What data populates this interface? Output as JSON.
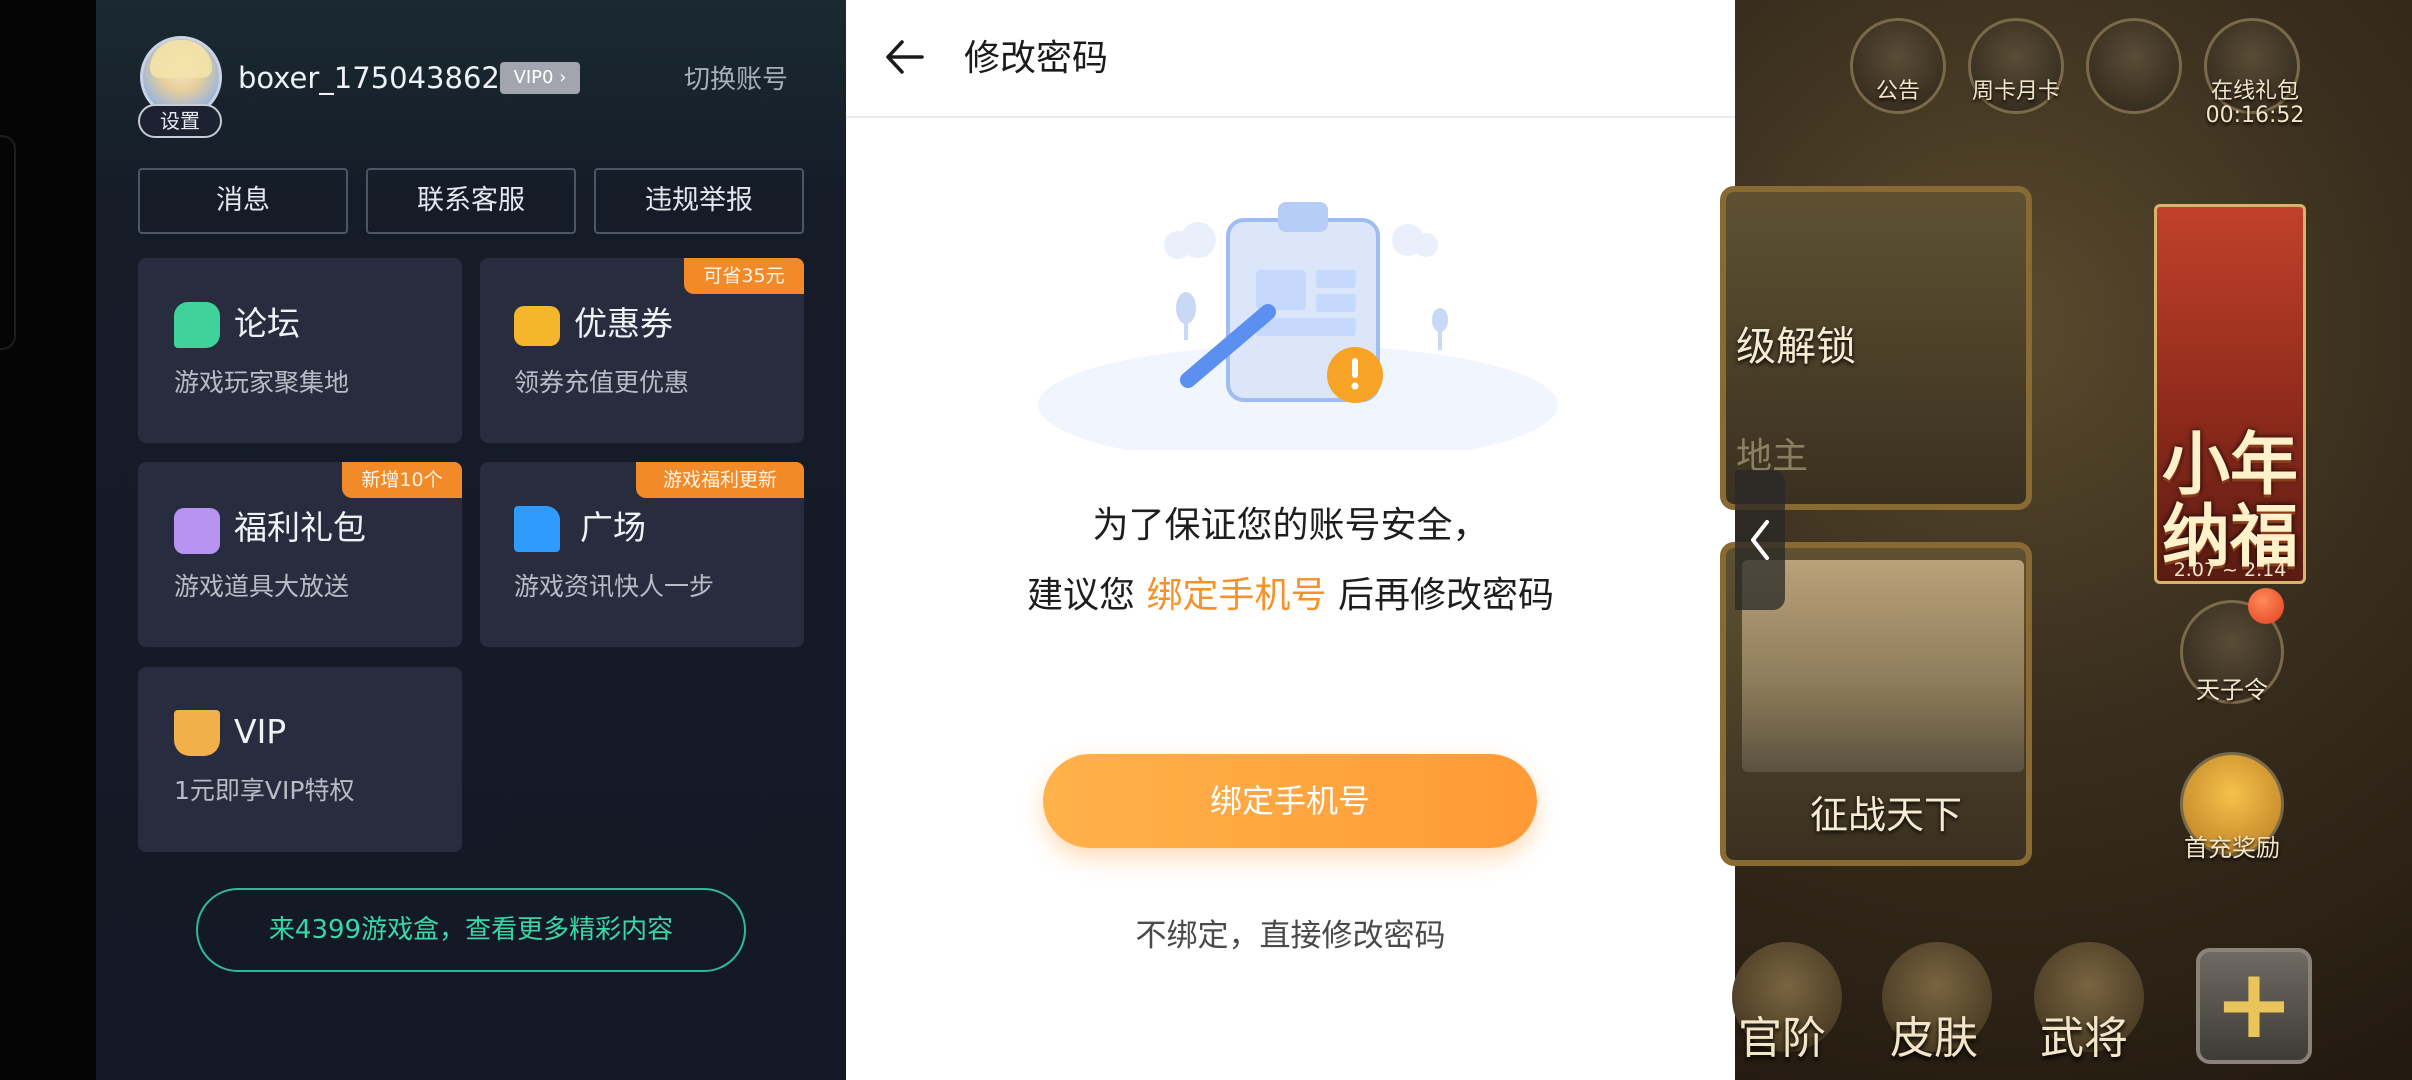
{
  "account_panel": {
    "settings_label": "设置",
    "username": "boxer_175043862rb",
    "vip_badge": "VIP0 ›",
    "switch_account": "切换账号",
    "top_buttons": [
      "消息",
      "联系客服",
      "违规举报"
    ],
    "cards": [
      {
        "title": "论坛",
        "subtitle": "游戏玩家聚集地",
        "icon": "chat-bubble-icon",
        "ribbon": ""
      },
      {
        "title": "优惠券",
        "subtitle": "领券充值更优惠",
        "icon": "coupon-icon",
        "ribbon": "可省35元"
      },
      {
        "title": "福利礼包",
        "subtitle": "游戏道具大放送",
        "icon": "gift-icon",
        "ribbon": "新增10个"
      },
      {
        "title": "广场",
        "subtitle": "游戏资讯快人一步",
        "icon": "flag-icon",
        "ribbon": "游戏福利更新"
      },
      {
        "title": "VIP",
        "subtitle": "1元即享VIP特权",
        "icon": "crown-icon",
        "ribbon": ""
      }
    ],
    "promo_banner": "来4399游戏盒，查看更多精彩内容"
  },
  "dialog": {
    "title": "修改密码",
    "message_line1": "为了保证您的账号安全，",
    "message_line2_pre": "建议您 ",
    "message_line2_highlight": "绑定手机号",
    "message_line2_post": " 后再修改密码",
    "bind_button": "绑定手机号",
    "skip_link": "不绑定，直接修改密码"
  },
  "game": {
    "top_icons": [
      {
        "label": "公告",
        "icon": "announcement-icon"
      },
      {
        "label": "周卡月卡",
        "icon": "card-icon"
      },
      {
        "label": "",
        "icon": "sword-icon"
      },
      {
        "label": "在线礼包",
        "icon": "giftbox-icon"
      }
    ],
    "timer": "00:16:52",
    "banner1_text": "级解锁",
    "banner1_sub": "地主",
    "banner2_text": "征战天下",
    "event_title": "小年纳福",
    "event_dates": "2.07 ~ 2.14",
    "side_icons": [
      {
        "label": "天子令",
        "icon": "token-icon"
      },
      {
        "label": "首充奖励",
        "icon": "first-recharge-icon"
      }
    ],
    "bottom_nav": [
      {
        "label": "官阶",
        "icon": "rank-icon"
      },
      {
        "label": "皮肤",
        "icon": "skin-icon"
      },
      {
        "label": "武将",
        "icon": "general-icon"
      }
    ],
    "plus_symbol": "+"
  },
  "colors": {
    "accent_orange": "#f7922b",
    "promo_green": "#39d6a6",
    "panel_bg": "#141826",
    "card_bg": "#272d3e",
    "ribbon_orange": "#f28a2a"
  }
}
